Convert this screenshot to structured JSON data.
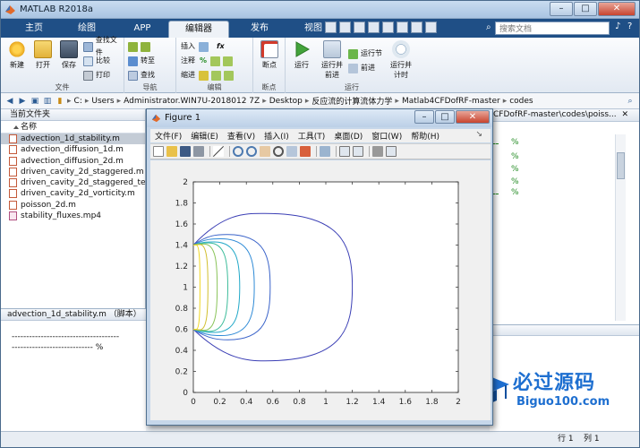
{
  "window": {
    "title": "MATLAB R2018a"
  },
  "tabs": [
    "主页",
    "绘图",
    "APP",
    "编辑器",
    "发布",
    "视图"
  ],
  "active_tab": "编辑器",
  "search": {
    "placeholder": "搜索文档"
  },
  "ribbon": {
    "file": {
      "label": "文件",
      "new": "新建",
      "open": "打开",
      "save": "保存",
      "find_files": "查找文件",
      "compare": "比较",
      "print": "打印"
    },
    "nav": {
      "label": "导航",
      "goto": "转至",
      "find": "查找"
    },
    "edit": {
      "label": "编辑",
      "insert": "插入",
      "comment": "注释",
      "indent": "缩进",
      "fx": "fx"
    },
    "breakpoints": {
      "label": "断点",
      "bp": "断点"
    },
    "run": {
      "label": "运行",
      "run": "运行",
      "run_advance": "运行并\n前进",
      "run_section": "运行节",
      "advance": "前进",
      "run_time": "运行并\n计时"
    }
  },
  "address": {
    "crumbs": [
      "C:",
      "Users",
      "Administrator.WIN7U-2018012 7Z",
      "Desktop",
      "反应流的计算流体力学",
      "Matlab4CFDofRF-master",
      "codes"
    ]
  },
  "left_pane": {
    "title": "当前文件夹",
    "col_name": "名称",
    "files": [
      "advection_1d_stability.m",
      "advection_diffusion_1d.m",
      "advection_diffusion_2d.m",
      "driven_cavity_2d_staggered.m",
      "driven_cavity_2d_staggered_temp",
      "driven_cavity_2d_vorticity.m",
      "poisson_2d.m",
      "stability_fluxes.mp4"
    ],
    "selected_index": 0,
    "details_label": "advection_1d_stability.m （脚本）",
    "preview_line1": "-------------------------------------",
    "preview_line2": "---------------------------- %"
  },
  "right_pane": {
    "header": "CFDofRF-master\\codes\\poiss..."
  },
  "figure": {
    "title": "Figure 1",
    "menu": [
      "文件(F)",
      "编辑(E)",
      "查看(V)",
      "插入(I)",
      "工具(T)",
      "桌面(D)",
      "窗口(W)",
      "帮助(H)"
    ]
  },
  "chart_data": {
    "type": "line",
    "title": "",
    "xlabel": "",
    "ylabel": "",
    "xlim": [
      0,
      2
    ],
    "ylim": [
      0,
      2
    ],
    "x_ticks": [
      "0",
      "0.2",
      "0.4",
      "0.6",
      "0.8",
      "1",
      "1.2",
      "1.4",
      "1.6",
      "1.8",
      "2"
    ],
    "y_ticks": [
      "0",
      "0.2",
      "0.4",
      "0.6",
      "0.8",
      "1",
      "1.2",
      "1.4",
      "1.6",
      "1.8",
      "2"
    ],
    "grid": false,
    "contour_center": [
      0,
      1
    ],
    "contour_radius_y": 0.4,
    "contours": [
      {
        "x_extent": 1.2,
        "y_extent": 0.7,
        "color": "#3b3fb5"
      },
      {
        "x_extent": 0.58,
        "y_extent": 0.5,
        "color": "#3a63c9"
      },
      {
        "x_extent": 0.46,
        "y_extent": 0.46,
        "color": "#2e8ad6"
      },
      {
        "x_extent": 0.35,
        "y_extent": 0.43,
        "color": "#21a8c8"
      },
      {
        "x_extent": 0.26,
        "y_extent": 0.42,
        "color": "#3cbc9a"
      },
      {
        "x_extent": 0.18,
        "y_extent": 0.41,
        "color": "#8ac45a"
      },
      {
        "x_extent": 0.11,
        "y_extent": 0.405,
        "color": "#d1bf2f"
      },
      {
        "x_extent": 0.05,
        "y_extent": 0.4,
        "color": "#f0d61f"
      }
    ]
  },
  "status": {
    "position": "行 1",
    "col": "列 1"
  },
  "watermark": {
    "line1": "必过源码",
    "line2": "Biguo100.com"
  }
}
